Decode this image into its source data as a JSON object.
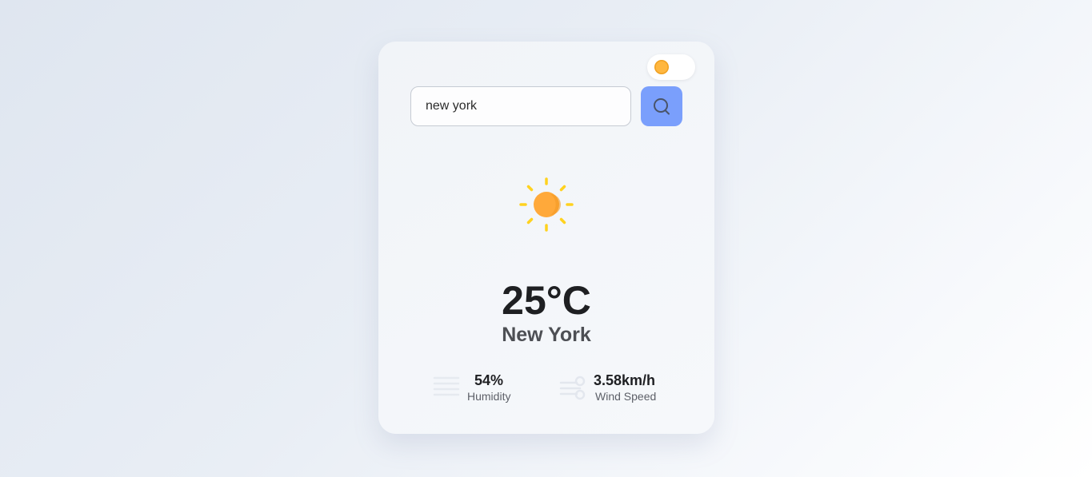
{
  "theme_toggle": {
    "icon": "sun-icon"
  },
  "search": {
    "value": "new york",
    "button_icon": "search-icon"
  },
  "weather": {
    "icon": "sun-icon",
    "temperature": "25°C",
    "city": "New York"
  },
  "details": {
    "humidity": {
      "icon": "humidity-icon",
      "value": "54%",
      "label": "Humidity"
    },
    "wind": {
      "icon": "wind-icon",
      "value": "3.58km/h",
      "label": "Wind Speed"
    }
  },
  "colors": {
    "accent": "#7a9ffc",
    "sun": "#ffb340",
    "sun_rays": "#ffd21f"
  }
}
